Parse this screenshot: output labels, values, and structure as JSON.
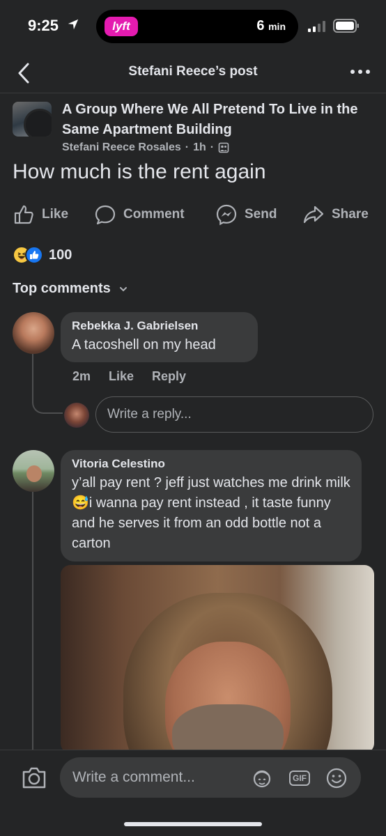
{
  "status_bar": {
    "time": "9:25",
    "lyft_label": "lyft",
    "eta_value": "6",
    "eta_unit": "min"
  },
  "nav": {
    "title": "Stefani Reece’s post"
  },
  "post": {
    "group_name": "A Group Where We All Pretend To Live in the Same Apartment Building",
    "author": "Stefani Reece Rosales",
    "time": "1h",
    "separator": "·",
    "text": "How much is the rent again"
  },
  "actions": {
    "like": "Like",
    "comment": "Comment",
    "send": "Send",
    "share": "Share"
  },
  "reactions": {
    "count": "100",
    "types": [
      "haha",
      "like"
    ]
  },
  "comments_header": {
    "label": "Top comments"
  },
  "comments": [
    {
      "name": "Rebekka J. Gabrielsen",
      "text": "A tacoshell on my head",
      "time": "2m",
      "like": "Like",
      "reply": "Reply"
    },
    {
      "name": "Vitoria Celestino",
      "text": "y’all pay rent ? jeff just watches me drink milk 😅i wanna pay rent instead , it taste funny and he serves it from an odd bottle not a carton"
    }
  ],
  "reply_input": {
    "placeholder": "Write a reply..."
  },
  "composer": {
    "placeholder": "Write a comment...",
    "gif_label": "GIF"
  },
  "colors": {
    "background": "#242526",
    "bubble": "#3a3b3c",
    "text_primary": "#e4e6eb",
    "text_secondary": "#b0b3b8",
    "lyft_pink": "#e41bb0",
    "like_blue": "#1877f2"
  },
  "icons": [
    "location-arrow-icon",
    "signal-icon",
    "battery-icon",
    "back-icon",
    "more-icon",
    "privacy-icon",
    "like-icon",
    "comment-icon",
    "messenger-icon",
    "share-icon",
    "chevron-down-icon",
    "camera-icon",
    "avatar-sticker-icon",
    "gif-icon",
    "emoji-icon"
  ]
}
